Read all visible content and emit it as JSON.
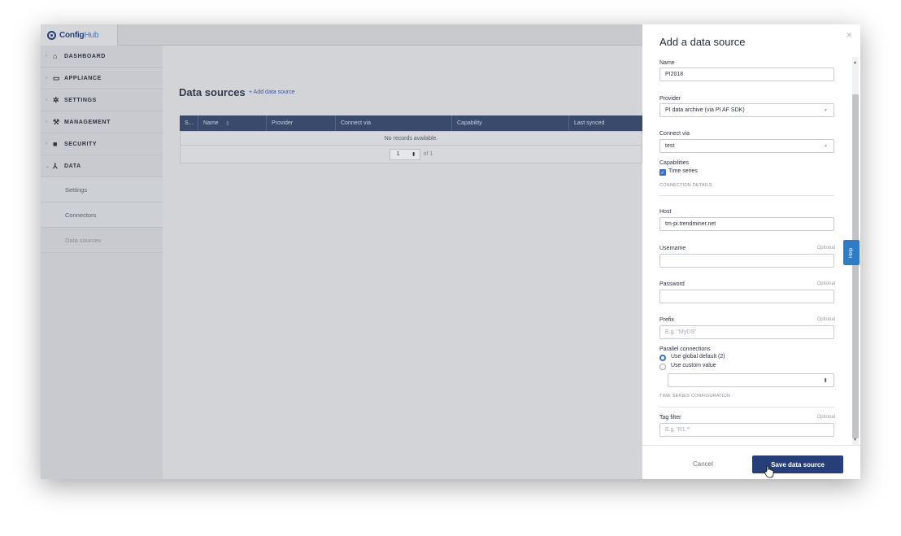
{
  "app": {
    "logo_part1": "Config",
    "logo_part2": "Hub"
  },
  "sidebar": {
    "items": [
      {
        "label": "DASHBOARD",
        "icon": "home-icon"
      },
      {
        "label": "APPLIANCE",
        "icon": "monitor-icon"
      },
      {
        "label": "SETTINGS",
        "icon": "gear-icon"
      },
      {
        "label": "MANAGEMENT",
        "icon": "wrench-icon"
      },
      {
        "label": "SECURITY",
        "icon": "lock-icon"
      },
      {
        "label": "DATA",
        "icon": "network-icon"
      }
    ],
    "subitems": [
      {
        "label": "Settings"
      },
      {
        "label": "Connectors"
      },
      {
        "label": "Data sources",
        "active": true
      }
    ]
  },
  "main": {
    "title": "Data sources",
    "add_link": "+ Add data source",
    "table": {
      "columns": [
        "S...",
        "Name",
        "Provider",
        "Connect via",
        "Capability",
        "Last synced"
      ],
      "empty_text": "No records available.",
      "page_value": "1",
      "page_total": "of 1"
    }
  },
  "panel": {
    "title": "Add a data source",
    "close_icon": "close-icon",
    "name": {
      "label": "Name",
      "value": "PI2018"
    },
    "provider": {
      "label": "Provider",
      "value": "PI data archive (via PI AF SDK)"
    },
    "connect_via": {
      "label": "Connect via",
      "value": "test"
    },
    "capabilities": {
      "label": "Capabilities",
      "time_series_label": "Time series",
      "time_series_checked": true
    },
    "connection_details_heading": "CONNECTION DETAILS",
    "host": {
      "label": "Host",
      "value": "tm-pi.trendminer.net"
    },
    "username": {
      "label": "Username",
      "optional": "Optional",
      "value": ""
    },
    "password": {
      "label": "Password",
      "optional": "Optional",
      "value": ""
    },
    "prefix": {
      "label": "Prefix",
      "optional": "Optional",
      "placeholder": "E.g. \"MyDS\""
    },
    "parallel": {
      "label": "Parallel connections",
      "option_global": "Use global default (2)",
      "option_custom": "Use custom value",
      "selected": "global"
    },
    "time_series_heading": "TIME SERIES CONFIGURATION",
    "tag_filter": {
      "label": "Tag filter",
      "optional": "Optional",
      "placeholder": "E.g. 'R1.*'"
    },
    "help_label": "Help",
    "cancel_label": "Cancel",
    "save_label": "Save data source"
  },
  "colors": {
    "primary": "#263f78",
    "accent": "#3a70c4",
    "help": "#2d7cc4",
    "table_header": "#3a4a6d"
  }
}
